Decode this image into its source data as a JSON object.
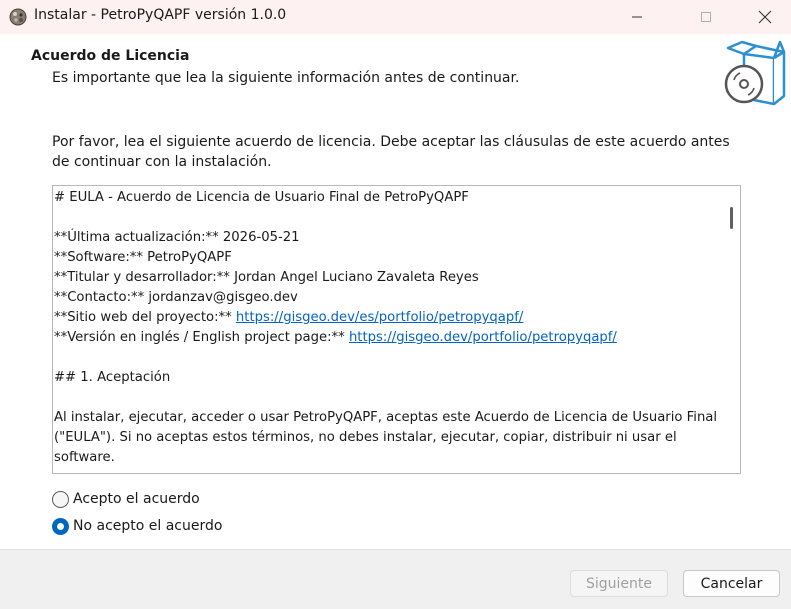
{
  "window": {
    "title": "Instalar - PetroPyQAPF versión 1.0.0"
  },
  "header": {
    "title": "Acuerdo de Licencia",
    "subtitle": "Es importante que lea la siguiente información antes de continuar."
  },
  "intro": "Por favor, lea el siguiente acuerdo de licencia. Debe aceptar las cláusulas de este acuerdo antes de continuar con la instalación.",
  "eula": {
    "heading": "# EULA - Acuerdo de Licencia de Usuario Final de PetroPyQAPF",
    "updated": "**Última actualización:** 2026-05-21",
    "software": "**Software:** PetroPyQAPF",
    "owner": "**Titular y desarrollador:** Jordan Angel Luciano Zavaleta Reyes",
    "contact": "**Contacto:** jordanzav@gisgeo.dev",
    "website_label": "**Sitio web del proyecto:** ",
    "website_url": "https://gisgeo.dev/es/portfolio/petropyqapf/",
    "english_label": "**Versión en inglés / English project page:** ",
    "english_url": "https://gisgeo.dev/portfolio/petropyqapf/",
    "section1": "## 1. Aceptación",
    "para1": "Al instalar, ejecutar, acceder o usar PetroPyQAPF, aceptas este Acuerdo de Licencia de Usuario Final (\"EULA\"). Si no aceptas estos términos, no debes instalar, ejecutar, copiar, distribuir ni usar el software."
  },
  "options": {
    "accept": "Acepto el acuerdo",
    "decline": "No acepto el acuerdo",
    "selected": "decline"
  },
  "buttons": {
    "next": "Siguiente",
    "cancel": "Cancelar"
  },
  "colors": {
    "accent": "#0067c0",
    "link": "#0563c1",
    "titlebar": "#fdf1f2",
    "footer": "#f0f0f0"
  }
}
